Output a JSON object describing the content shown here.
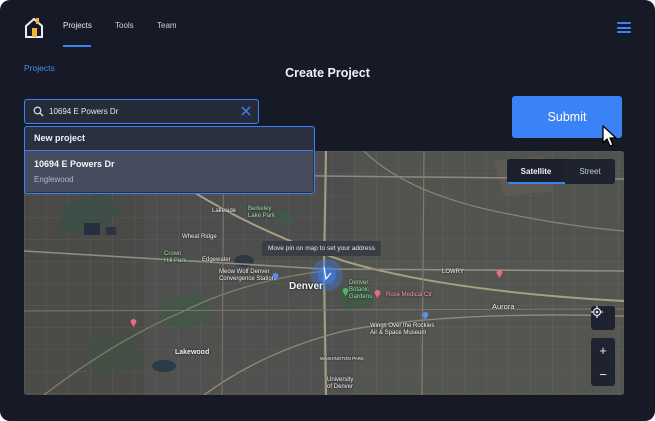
{
  "nav": {
    "items": [
      {
        "label": "Projects",
        "active": true
      },
      {
        "label": "Tools",
        "active": false
      },
      {
        "label": "Team",
        "active": false
      }
    ],
    "menu_icon": "hamburger-icon"
  },
  "breadcrumb": "Projects",
  "page_title": "Create Project",
  "search": {
    "value": "10694 E Powers Dr",
    "placeholder": "",
    "icon": "search-icon",
    "clear_icon": "close-icon"
  },
  "dropdown": {
    "new_label": "New project",
    "item_title": "10694 E Powers Dr",
    "item_subtitle": "Englewood"
  },
  "submit_label": "Submit",
  "map": {
    "tabs": {
      "satellite": "Satellite",
      "street": "Street",
      "selected": "Satellite"
    },
    "tooltip": "Move pin on map to set your address",
    "labels": {
      "lakeside": "Lakeside",
      "berkeley_lake": "Berkeley\nLake Park",
      "wheat_ridge": "Wheat Ridge",
      "crown_hill": "Crown\nHill Park",
      "edgewater": "Edgewater",
      "meow_wolf": "Meow Wolf Denver\nConvergence Station",
      "denver": "Denver",
      "botanic": "Denver\nBotanic\nGardens",
      "rose": "Rose Medical Ctr",
      "lakewood": "Lakewood",
      "aurora": "Aurora",
      "wings": "Wings Over the Rockies\nAir & Space Museum",
      "u_denver": "University\nof Denver",
      "washington_park": "WASHINGTON PARK",
      "lowry": "LOWRY"
    },
    "controls": [
      "locate-icon",
      "zoom-in-icon",
      "zoom-out-icon"
    ],
    "zoom_in": "+",
    "zoom_out": "−",
    "colors": {
      "accent": "#3b82f6",
      "map_base": "#4b4d4e"
    }
  }
}
